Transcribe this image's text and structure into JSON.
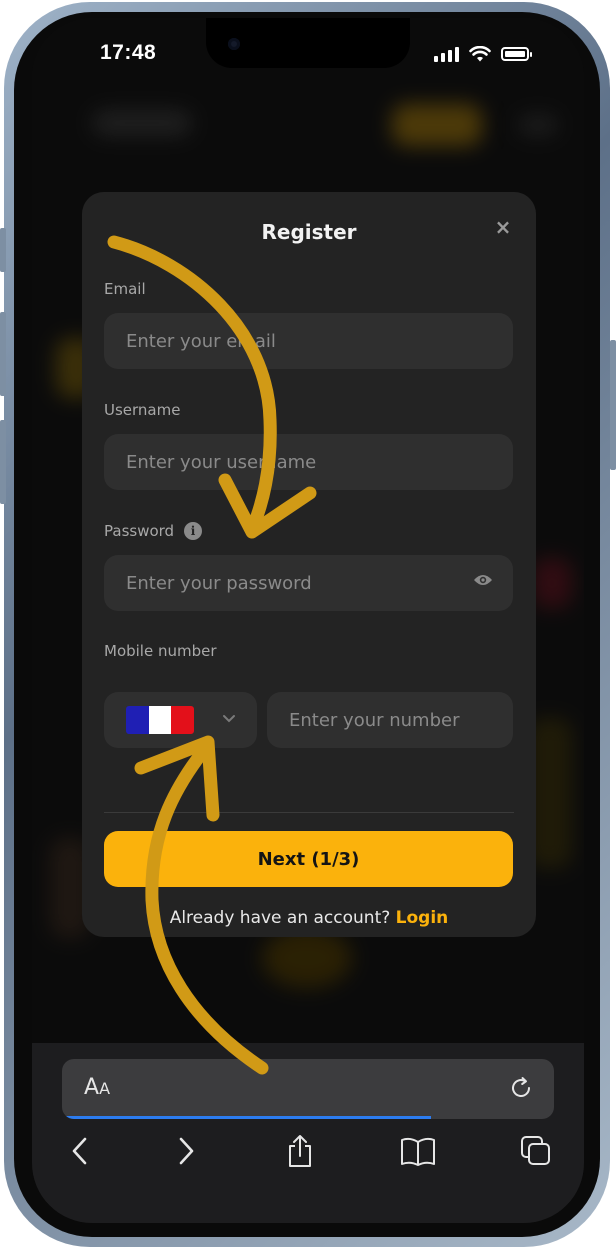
{
  "status_bar": {
    "time": "17:48"
  },
  "modal": {
    "title": "Register",
    "close_icon": "×",
    "email": {
      "label": "Email",
      "placeholder": "Enter your email"
    },
    "username": {
      "label": "Username",
      "placeholder": "Enter your username"
    },
    "password": {
      "label": "Password",
      "placeholder": "Enter your password",
      "info_icon": "i"
    },
    "mobile": {
      "label": "Mobile number",
      "country": "France",
      "placeholder": "Enter your number"
    },
    "next_button": "Next (1/3)",
    "login_prompt": "Already have an account?",
    "login_link": "Login"
  },
  "browser": {
    "address_label": "AA",
    "load_progress_percent": 75
  },
  "colors": {
    "accent": "#fbb20c",
    "modal_bg": "#232323",
    "input_bg": "#2f2f2f",
    "arrow": "#d19a16",
    "progress": "#2c7cf0"
  },
  "icons": [
    "close-icon",
    "info-icon",
    "eye-icon",
    "chevron-down-icon",
    "reload-icon",
    "back-icon",
    "forward-icon",
    "share-icon",
    "bookmarks-icon",
    "tabs-icon",
    "wifi-icon",
    "battery-icon",
    "signal-icon"
  ]
}
